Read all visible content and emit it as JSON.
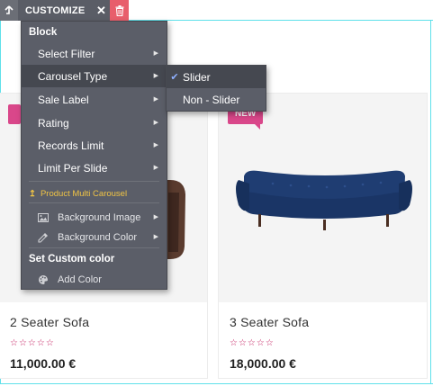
{
  "toolbar": {
    "up_icon": "arrow-up-icon",
    "title": "CUSTOMIZE",
    "close_glyph": "✕",
    "delete_icon": "trash-icon"
  },
  "menu": {
    "block_heading": "Block",
    "items": [
      {
        "label": "Select Filter"
      },
      {
        "label": "Carousel Type"
      },
      {
        "label": "Sale Label"
      },
      {
        "label": "Rating"
      },
      {
        "label": "Records Limit"
      },
      {
        "label": "Limit Per Slide"
      }
    ],
    "product_multi_carousel": "Product Multi Carousel",
    "bg_image": "Background Image",
    "bg_color": "Background Color",
    "custom_color_heading": "Set Custom color",
    "add_color": "Add Color"
  },
  "submenu": {
    "items": [
      {
        "label": "Slider",
        "selected": true
      },
      {
        "label": "Non - Slider",
        "selected": false
      }
    ]
  },
  "products": [
    {
      "name": "2 Seater Sofa",
      "price": "11,000.00 €",
      "rating": "☆☆☆☆☆",
      "badge": ""
    },
    {
      "name": "3 Seater Sofa",
      "price": "18,000.00 €",
      "rating": "☆☆☆☆☆",
      "badge": "NEW"
    }
  ],
  "colors": {
    "selection_outline": "#5fe0ea",
    "menu_bg": "#5b5e68",
    "delete_button": "#e85e6c",
    "badge": "#d9478a",
    "sofa": "#1f3d72",
    "accent_yellow": "#f0c445"
  }
}
